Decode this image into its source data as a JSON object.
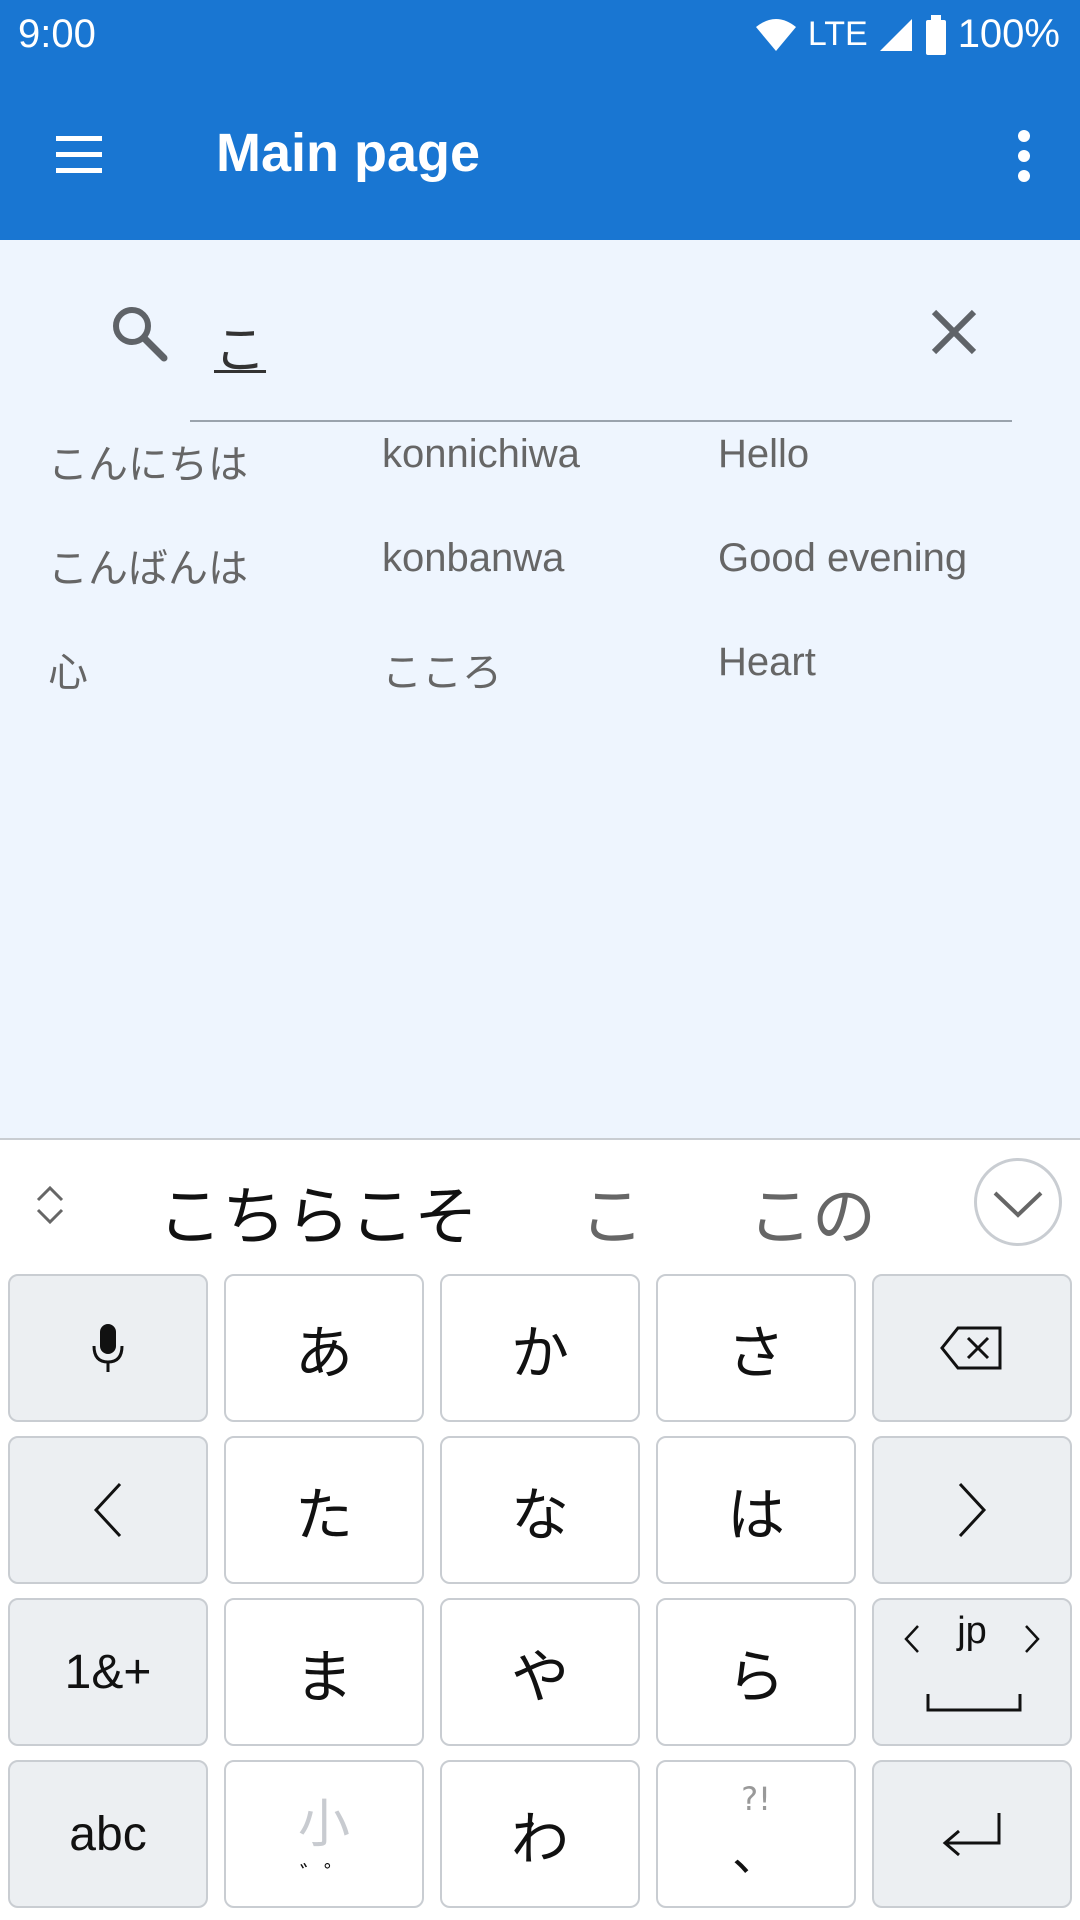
{
  "status_bar": {
    "time": "9:00",
    "network": "LTE",
    "battery": "100%"
  },
  "app_bar": {
    "title": "Main page",
    "menu_icon": "menu-icon",
    "more_icon": "more-vert-icon"
  },
  "search": {
    "query": "こ",
    "search_icon": "search-icon",
    "clear_icon": "close-icon"
  },
  "results": [
    {
      "japanese": "こんにちは",
      "romaji": "konnichiwa",
      "english": "Hello"
    },
    {
      "japanese": "こんばんは",
      "romaji": "konbanwa",
      "english": "Good evening"
    },
    {
      "japanese": "心",
      "romaji": "こころ",
      "english": "Heart"
    }
  ],
  "keyboard": {
    "candidates": [
      "こちらこそ",
      "こ",
      "この"
    ],
    "keys": {
      "row1": [
        "mic",
        "あ",
        "か",
        "さ",
        "backspace"
      ],
      "row2": [
        "<",
        "た",
        "な",
        "は",
        ">"
      ],
      "row3": [
        "1&+",
        "ま",
        "や",
        "ら",
        "jp"
      ],
      "row4": [
        "abc",
        "小",
        "わ",
        "、",
        "enter"
      ]
    },
    "small_kana_hint": "小",
    "small_kana_marks": "゛゜",
    "punct_hint": "?!",
    "space_label": "jp"
  },
  "colors": {
    "primary": "#1976d2",
    "background": "#eef5fe",
    "key_fn": "#eceff2"
  }
}
